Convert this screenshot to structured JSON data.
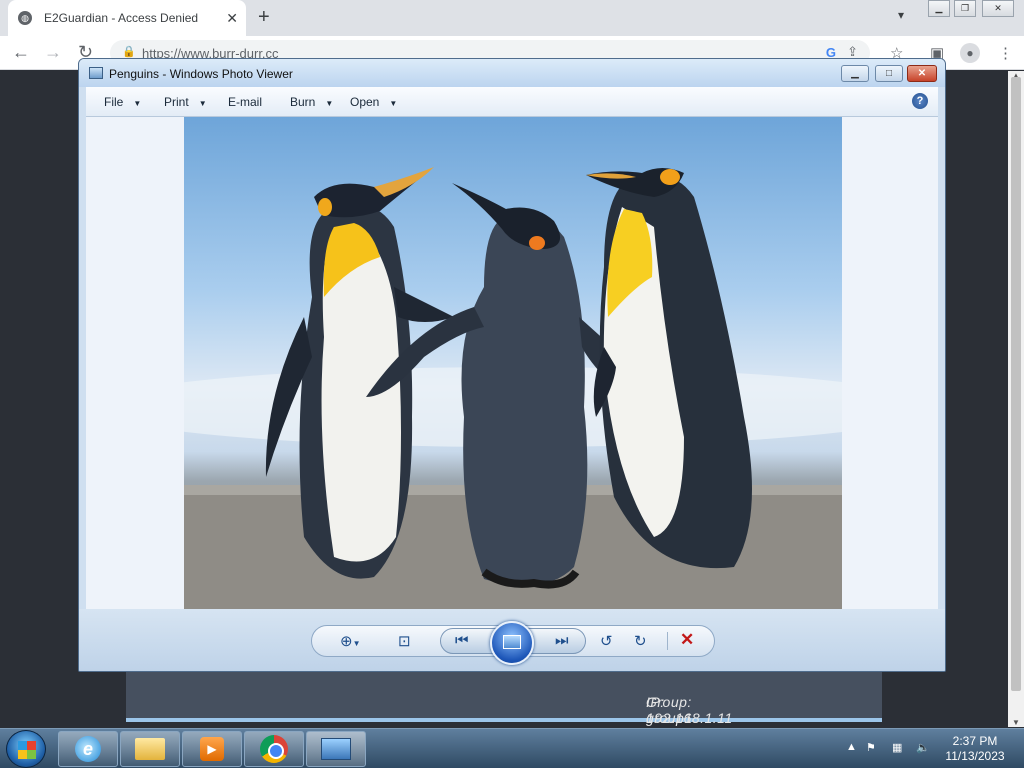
{
  "browser": {
    "tab_title": "E2Guardian - Access Denied",
    "tab_close": "✕",
    "new_tab": "+",
    "url": "https://www.burr-durr.cc"
  },
  "page": {
    "group_label": "Group: group1",
    "ip_label": "IP: 192.168.1.11"
  },
  "photo_viewer": {
    "title": "Penguins - Windows Photo Viewer",
    "menu": [
      "File",
      "Print",
      "E-mail",
      "Burn",
      "Open"
    ],
    "help": "?"
  },
  "taskbar": {
    "time": "2:37 PM",
    "date": "11/13/2023"
  },
  "colors": {
    "taskbar": "#3f5f7f",
    "viewer_frame": "#cfdff0",
    "delete": "#c21818"
  },
  "icons": {
    "browser_back": "arrow-left",
    "browser_forward": "arrow-right",
    "browser_reload": "reload",
    "viewer_zoom": "magnifier-plus",
    "viewer_fit": "actual-size",
    "viewer_prev": "skip-previous",
    "viewer_next": "skip-next",
    "viewer_slideshow": "slideshow",
    "viewer_rotate_ccw": "rotate-counterclockwise",
    "viewer_rotate_cw": "rotate-clockwise",
    "viewer_delete": "red-x"
  }
}
